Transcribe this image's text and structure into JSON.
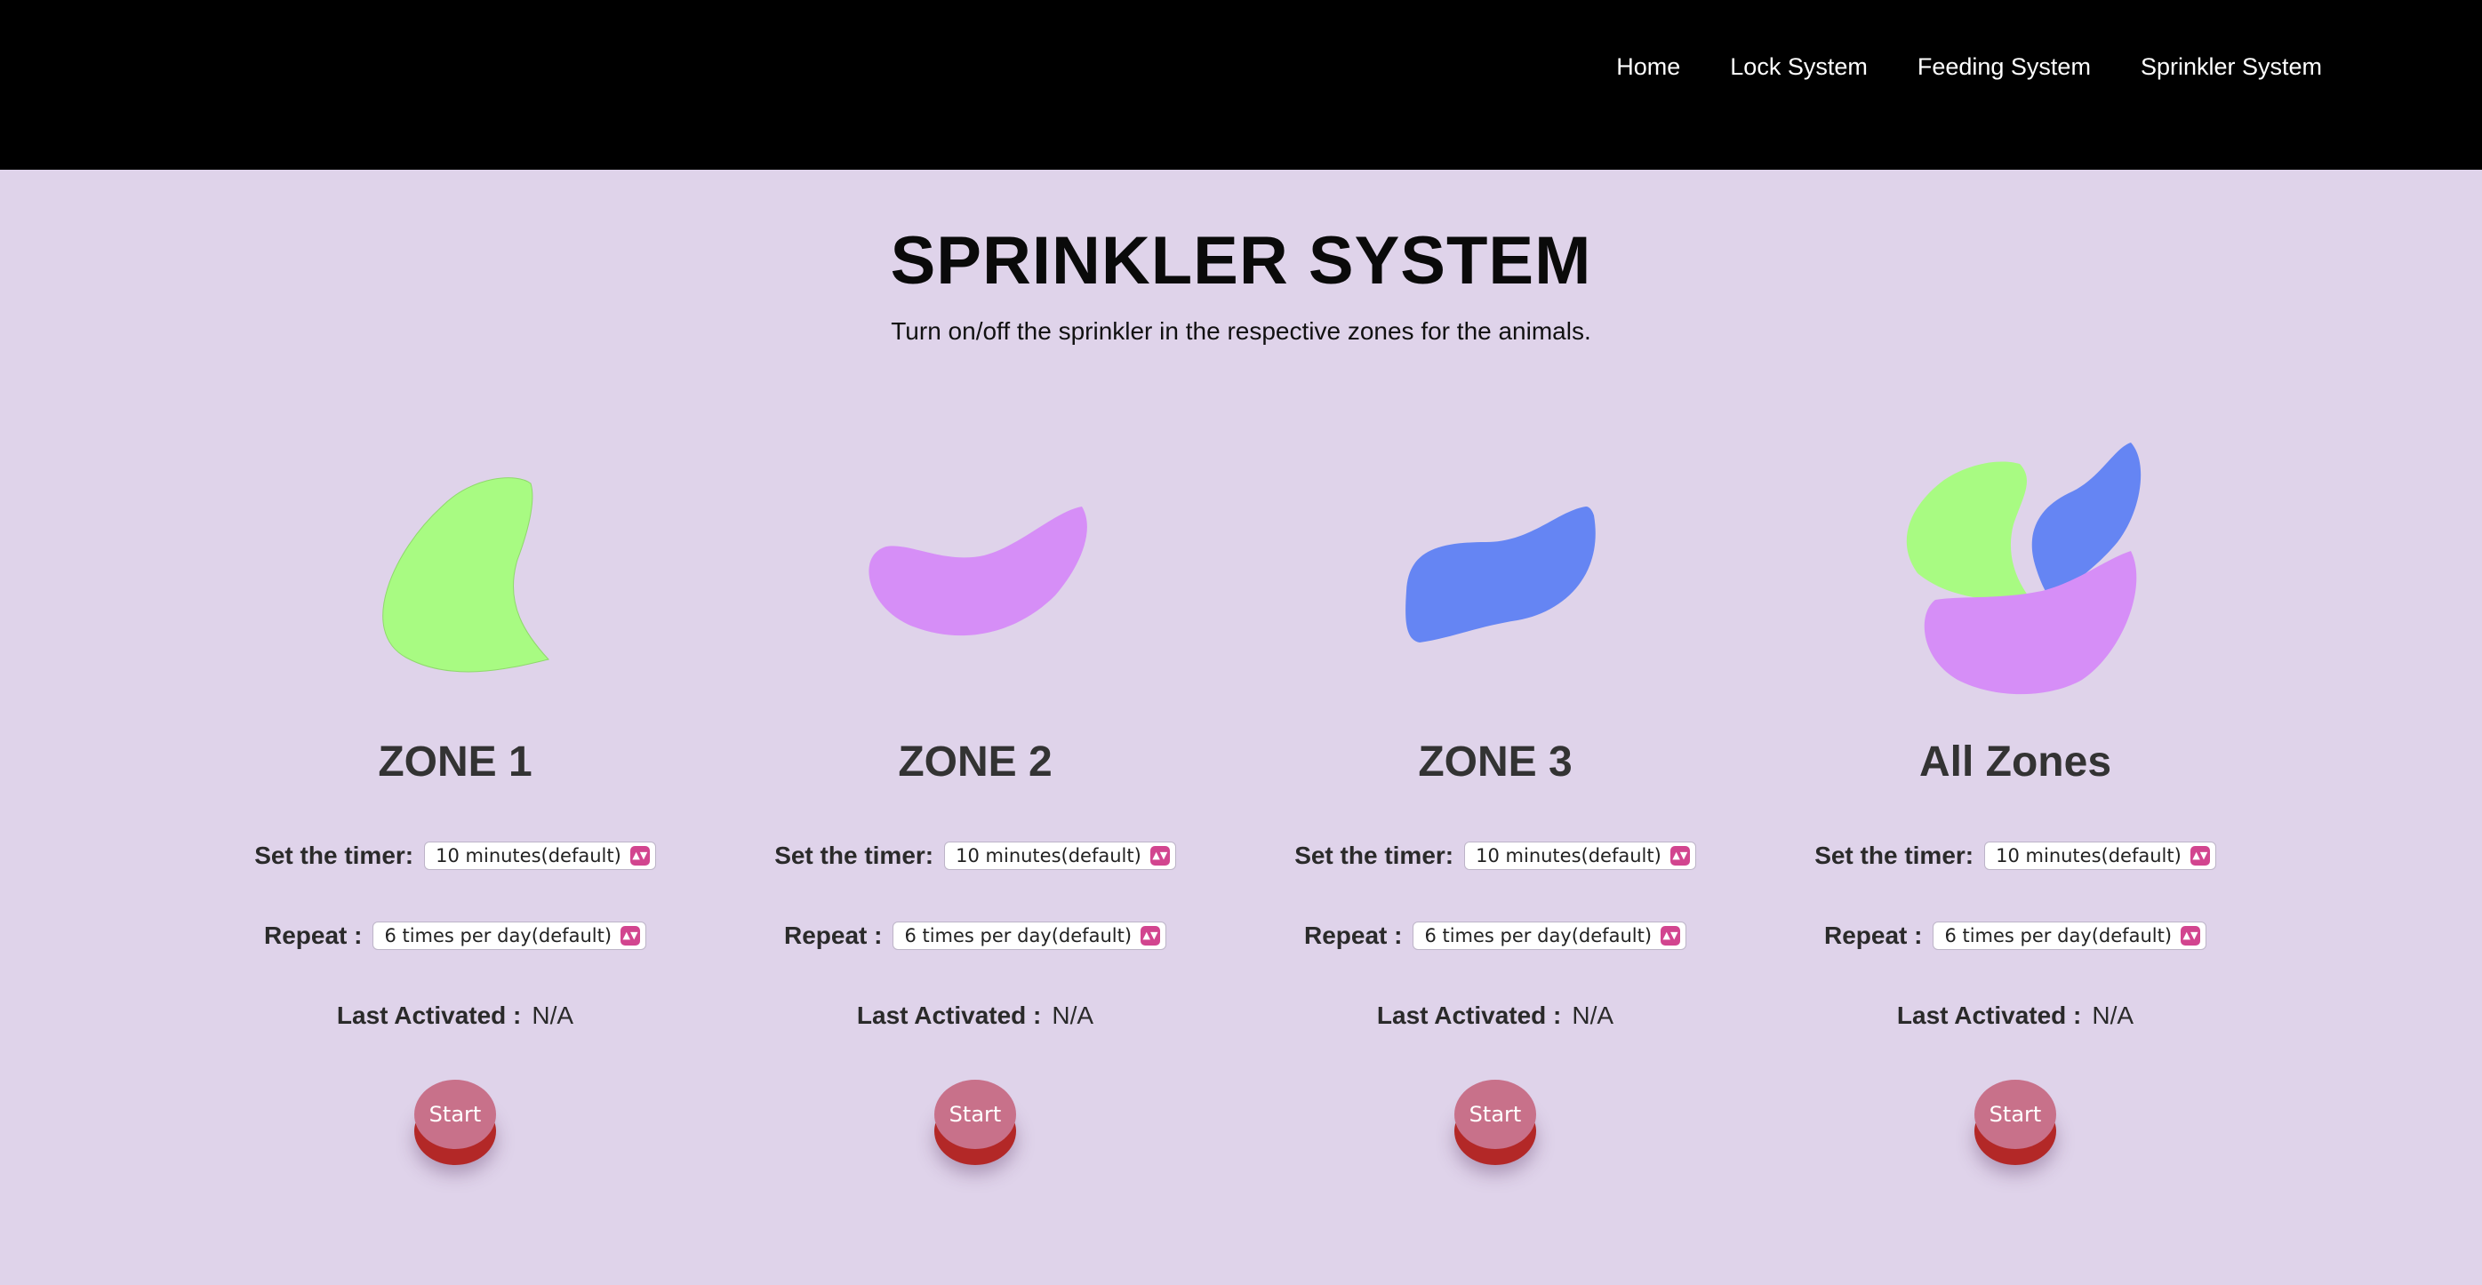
{
  "nav": {
    "items": [
      "Home",
      "Lock System",
      "Feeding System",
      "Sprinkler System"
    ]
  },
  "header": {
    "title": "SPRINKLER SYSTEM",
    "subtitle": "Turn on/off the sprinkler in the respective zones for the animals."
  },
  "labels": {
    "timer": "Set the timer:",
    "repeat": "Repeat :",
    "last": "Last Activated :",
    "start": "Start"
  },
  "zones": [
    {
      "title": "ZONE 1",
      "timer": "10 minutes(default)",
      "repeat": "6 times per day(default)",
      "last": "N/A"
    },
    {
      "title": "ZONE 2",
      "timer": "10 minutes(default)",
      "repeat": "6 times per day(default)",
      "last": "N/A"
    },
    {
      "title": "ZONE 3",
      "timer": "10 minutes(default)",
      "repeat": "6 times per day(default)",
      "last": "N/A"
    },
    {
      "title": "All Zones",
      "timer": "10 minutes(default)",
      "repeat": "6 times per day(default)",
      "last": "N/A"
    }
  ],
  "colors": {
    "background": "#dfd3ea",
    "green_blob": "#a8fb82",
    "purple_blob": "#d68ef7",
    "blue_blob": "#6585f3",
    "start_button": "#c8718a",
    "start_base": "#b32827",
    "select_accent": "#d2458f"
  }
}
